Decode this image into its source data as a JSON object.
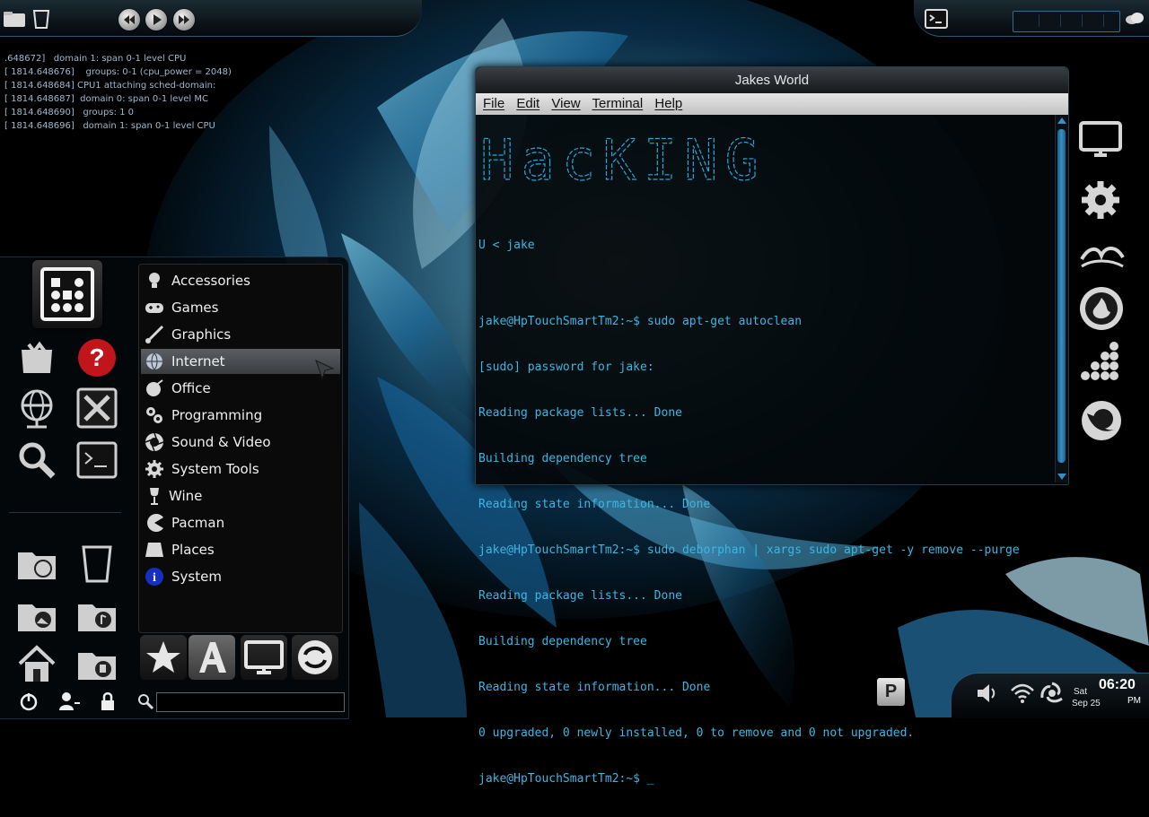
{
  "colors": {
    "accent": "#3cb6e2",
    "terminal_text": "#3cb6e2",
    "panel_border": "#2e5c78",
    "menu_selected": "#4a4e52"
  },
  "top_panel": {
    "icons": [
      "folder-icon",
      "trash-icon",
      "prev-track-icon",
      "play-icon",
      "next-track-icon",
      "terminal-icon",
      "weather-icon"
    ]
  },
  "boot_log": [
    ".648672]   domain 1: span 0-1 level CPU",
    "[ 1814.648676]    groups: 0-1 (cpu_power = 2048)",
    "[ 1814.648684] CPU1 attaching sched-domain:",
    "[ 1814.648687]  domain 0: span 0-1 level MC",
    "[ 1814.648690]   groups: 1 0",
    "[ 1814.648696]   domain 1: span 0-1 level CPU"
  ],
  "terminal": {
    "title": "Jakes World",
    "menu": [
      "File",
      "Edit",
      "View",
      "Terminal",
      "Help"
    ],
    "ascii_art": "HacKING",
    "lines": [
      "U < jake",
      "",
      "jake@HpTouchSmartTm2:~$ sudo apt-get autoclean",
      "[sudo] password for jake:",
      "Reading package lists... Done",
      "Building dependency tree",
      "Reading state information... Done",
      "jake@HpTouchSmartTm2:~$ sudo deborphan | xargs sudo apt-get -y remove --purge",
      "Reading package lists... Done",
      "Building dependency tree",
      "Reading state information... Done",
      "0 upgraded, 0 newly installed, 0 to remove and 0 not upgraded.",
      "jake@HpTouchSmartTm2:~$ _"
    ]
  },
  "launcher": {
    "categories": [
      {
        "label": "Accessories",
        "icon": "bulb-icon"
      },
      {
        "label": "Games",
        "icon": "gamepad-icon"
      },
      {
        "label": "Graphics",
        "icon": "brush-icon"
      },
      {
        "label": "Internet",
        "icon": "globe-icon",
        "selected": true
      },
      {
        "label": "Office",
        "icon": "office-icon"
      },
      {
        "label": "Programming",
        "icon": "gears-icon"
      },
      {
        "label": "Sound & Video",
        "icon": "aperture-icon"
      },
      {
        "label": "System Tools",
        "icon": "gear-icon"
      },
      {
        "label": "Wine",
        "icon": "wine-glass-icon"
      },
      {
        "label": "Pacman",
        "icon": "pacman-icon"
      },
      {
        "label": "Places",
        "icon": "drive-icon"
      },
      {
        "label": "System",
        "icon": "info-icon"
      }
    ],
    "search_placeholder": ""
  },
  "clock": {
    "time": "06:20",
    "ampm": "PM",
    "day": "Sat",
    "date": "Sep 25"
  },
  "bottom_panel": {
    "pager_label": "P"
  }
}
